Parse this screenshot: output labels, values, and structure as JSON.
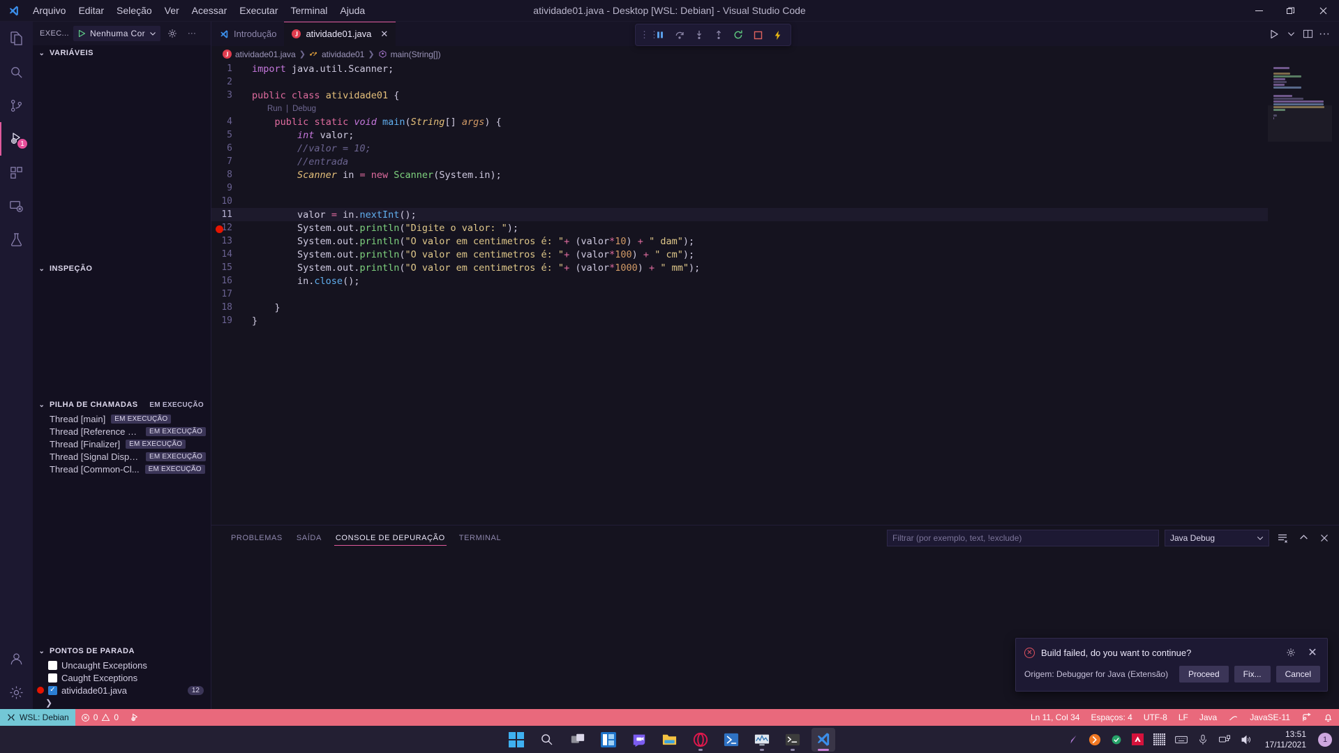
{
  "titlebar": {
    "title": "atividade01.java - Desktop [WSL: Debian] - Visual Studio Code",
    "menus": [
      "Arquivo",
      "Editar",
      "Seleção",
      "Ver",
      "Acessar",
      "Executar",
      "Terminal",
      "Ajuda"
    ],
    "minimize": "—",
    "maximize": "❐",
    "close": "✕"
  },
  "activitybar": {
    "items": [
      {
        "name": "explorer",
        "badge": ""
      },
      {
        "name": "search",
        "badge": ""
      },
      {
        "name": "source-control",
        "badge": ""
      },
      {
        "name": "run-and-debug",
        "badge": "1"
      },
      {
        "name": "extensions",
        "badge": ""
      },
      {
        "name": "remote-explorer",
        "badge": ""
      },
      {
        "name": "testing",
        "badge": ""
      }
    ]
  },
  "sidebar": {
    "header": {
      "title": "EXEC...",
      "launch_config": "Nenhuma Cor",
      "gear_tooltip": "Abrir configurações",
      "more": "···"
    },
    "variables": {
      "title": "VARIÁVEIS"
    },
    "watch": {
      "title": "INSPEÇÃO"
    },
    "callstack": {
      "title": "PILHA DE CHAMADAS",
      "state": "EM EXECUÇÃO",
      "threads": [
        {
          "name": "Thread [main]",
          "state": "EM EXECUÇÃO"
        },
        {
          "name": "Thread [Reference H...",
          "state": "EM EXECUÇÃO"
        },
        {
          "name": "Thread [Finalizer]",
          "state": "EM EXECUÇÃO"
        },
        {
          "name": "Thread [Signal Dispa...",
          "state": "EM EXECUÇÃO"
        },
        {
          "name": "Thread [Common-Cl...",
          "state": "EM EXECUÇÃO"
        }
      ]
    },
    "breakpoints": {
      "title": "PONTOS DE PARADA",
      "items": [
        {
          "label": "Uncaught Exceptions",
          "checked": false,
          "has_dot": false,
          "count": ""
        },
        {
          "label": "Caught Exceptions",
          "checked": false,
          "has_dot": false,
          "count": ""
        },
        {
          "label": "atividade01.java",
          "checked": true,
          "has_dot": true,
          "count": "12"
        }
      ]
    }
  },
  "tabs": [
    {
      "label": "Introdução",
      "icon": "vscode-icon",
      "active": false
    },
    {
      "label": "atividade01.java",
      "icon": "java-icon",
      "active": true
    }
  ],
  "breadcrumbs": [
    "atividade01.java",
    "atividade01",
    "main(String[])"
  ],
  "debug_toolbar": {
    "buttons": [
      "pause",
      "step-over",
      "step-into",
      "step-out",
      "restart",
      "stop",
      "hot-reload"
    ]
  },
  "editor": {
    "codelens": [
      "Run",
      "Debug"
    ],
    "current_line": 11,
    "breakpoint_line": 12,
    "lines": [
      {
        "n": 1,
        "html": "<span class=\"k\">import</span> <span class=\"pl\">java.util.Scanner;</span>"
      },
      {
        "n": 2,
        "html": ""
      },
      {
        "n": 3,
        "html": "<span class=\"kw\">public</span> <span class=\"kw\">class</span> <span class=\"typ\">atividade01</span> <span class=\"pl\">{</span>"
      },
      {
        "n": 4,
        "html": "    <span class=\"kw\">public</span> <span class=\"kw\">static</span> <span class=\"k ita\">void</span> <span class=\"fn\">main</span><span class=\"pl\">(</span><span class=\"typ ita\">String</span><span class=\"pl\">[] </span><span class=\"num ita\">args</span><span class=\"pl\">) {</span>"
      },
      {
        "n": 5,
        "html": "        <span class=\"k ita\">int</span> <span class=\"pl\">valor;</span>"
      },
      {
        "n": 6,
        "html": "        <span class=\"cm\">//valor = 10;</span>"
      },
      {
        "n": 7,
        "html": "        <span class=\"cm\">//entrada</span>"
      },
      {
        "n": 8,
        "html": "        <span class=\"typ ita\">Scanner</span> <span class=\"pl\">in </span><span class=\"op\">=</span> <span class=\"kw\">new</span> <span class=\"grn\">Scanner</span><span class=\"pl\">(System.in);</span>"
      },
      {
        "n": 9,
        "html": ""
      },
      {
        "n": 10,
        "html": ""
      },
      {
        "n": 11,
        "html": "        <span class=\"pl\">valor </span><span class=\"op\">=</span> <span class=\"pl\">in.</span><span class=\"fn\">nextInt</span><span class=\"pl\">();</span>"
      },
      {
        "n": 12,
        "html": "        <span class=\"pl\">System.out.</span><span class=\"grn\">println</span><span class=\"pl\">(</span><span class=\"str\">\"Digite o valor: \"</span><span class=\"pl\">);</span>"
      },
      {
        "n": 13,
        "html": "        <span class=\"pl\">System.out.</span><span class=\"grn\">println</span><span class=\"pl\">(</span><span class=\"str\">\"O valor em centimetros é: \"</span><span class=\"op\">+</span> <span class=\"pl\">(valor</span><span class=\"op\">*</span><span class=\"num\">10</span><span class=\"pl\">) </span><span class=\"op\">+</span> <span class=\"str\">\" dam\"</span><span class=\"pl\">);</span>"
      },
      {
        "n": 14,
        "html": "        <span class=\"pl\">System.out.</span><span class=\"grn\">println</span><span class=\"pl\">(</span><span class=\"str\">\"O valor em centimetros é: \"</span><span class=\"op\">+</span> <span class=\"pl\">(valor</span><span class=\"op\">*</span><span class=\"num\">100</span><span class=\"pl\">) </span><span class=\"op\">+</span> <span class=\"str\">\" cm\"</span><span class=\"pl\">);</span>"
      },
      {
        "n": 15,
        "html": "        <span class=\"pl\">System.out.</span><span class=\"grn\">println</span><span class=\"pl\">(</span><span class=\"str\">\"O valor em centimetros é: \"</span><span class=\"op\">+</span> <span class=\"pl\">(valor</span><span class=\"op\">*</span><span class=\"num\">1000</span><span class=\"pl\">) </span><span class=\"op\">+</span> <span class=\"str\">\" mm\"</span><span class=\"pl\">);</span>"
      },
      {
        "n": 16,
        "html": "        <span class=\"pl\">in.</span><span class=\"fn\">close</span><span class=\"pl\">();</span>"
      },
      {
        "n": 17,
        "html": ""
      },
      {
        "n": 18,
        "html": "    <span class=\"pl\">}</span>"
      },
      {
        "n": 19,
        "html": "<span class=\"pl\">}</span>"
      }
    ]
  },
  "panel": {
    "tabs": [
      "PROBLEMAS",
      "SAÍDA",
      "CONSOLE DE DEPURAÇÃO",
      "TERMINAL"
    ],
    "active_tab": "CONSOLE DE DEPURAÇÃO",
    "filter_placeholder": "Filtrar (por exemplo, text, !exclude)",
    "filter_value": "",
    "session_select": "Java Debug",
    "content": ""
  },
  "notification": {
    "message": "Build failed, do you want to continue?",
    "source": "Origem: Debugger for Java (Extensão)",
    "buttons": [
      "Proceed",
      "Fix...",
      "Cancel"
    ],
    "gear": "gear-icon",
    "close": "✕"
  },
  "statusbar": {
    "remote": "WSL: Debian",
    "errors": "0",
    "warnings": "0",
    "position": "Ln 11, Col 34",
    "indentation": "Espaços: 4",
    "encoding": "UTF-8",
    "eol": "LF",
    "language": "Java",
    "jdk": "JavaSE-11"
  },
  "taskbar": {
    "icons": [
      "start",
      "search",
      "task-view",
      "widgets",
      "teams",
      "file-explorer",
      "opera",
      "powershell",
      "performance-monitor",
      "terminal",
      "vscode"
    ],
    "tray": [
      "pen",
      "opera-gx",
      "green-dot",
      "amd",
      "grid",
      "keyboard",
      "microphone",
      "network",
      "volume"
    ],
    "time": "13:51",
    "date": "17/11/2021",
    "notification_count": "1"
  }
}
